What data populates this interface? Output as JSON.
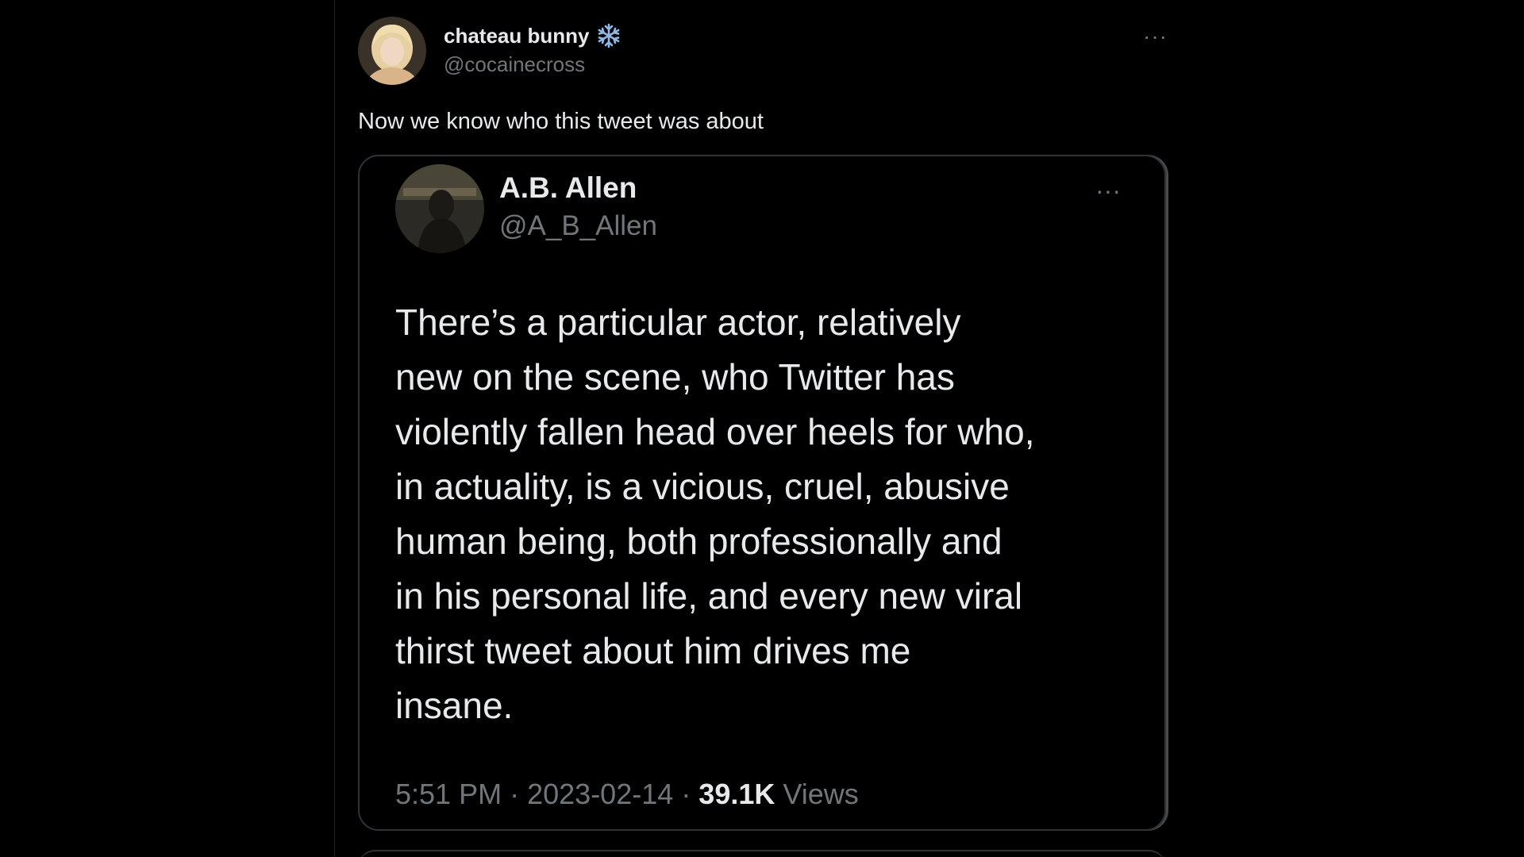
{
  "tweet": {
    "author": {
      "display_name": "chateau bunny",
      "handle": "@cocainecross",
      "badge_icon": "snowflake-icon",
      "more_label": "···"
    },
    "text": "Now we know who this tweet was about",
    "quoted": {
      "author": {
        "display_name": "A.B. Allen",
        "handle": "@A_B_Allen",
        "more_label": "···"
      },
      "lines": [
        "There’s a particular actor, relatively",
        "new on the scene, who Twitter has",
        "violently fallen head over heels for who,",
        "in actuality, is a vicious, cruel, abusive",
        "human being, both professionally and",
        "in his personal life, and every new viral",
        "thirst tweet about him drives me",
        "insane."
      ],
      "meta": {
        "time": "5:51 PM",
        "separator": "·",
        "date": "2023-02-14",
        "views_count": "39.1K",
        "views_label": "Views"
      }
    }
  },
  "colors": {
    "background": "#000000",
    "primary_text": "#e7e9ea",
    "secondary_text": "#71767b",
    "border": "#2f3336",
    "snowflake": "#8fb8e6"
  }
}
